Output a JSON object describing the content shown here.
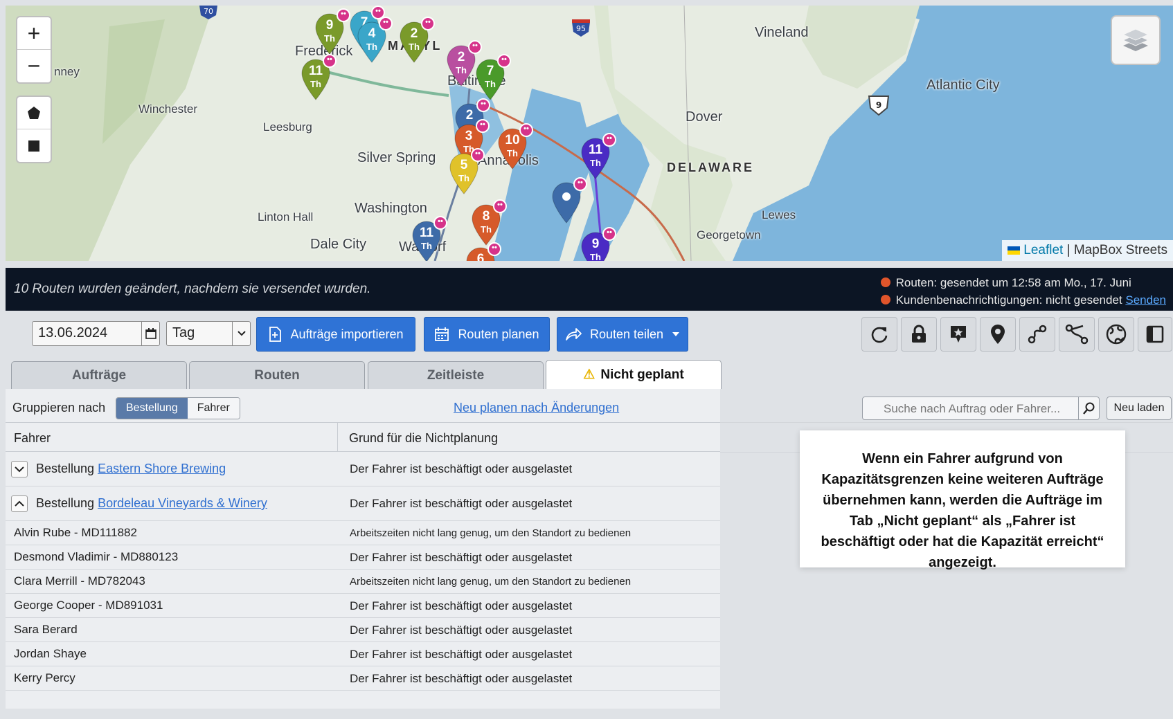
{
  "map": {
    "zoom_in": "+",
    "zoom_out": "−",
    "labels": [
      {
        "text": "Vineland",
        "cls": "big"
      },
      {
        "text": "Frederick",
        "cls": "big"
      },
      {
        "text": "MARYL",
        "cls": "state"
      },
      {
        "text": "Baltimore",
        "cls": "big"
      },
      {
        "text": "Atlantic City",
        "cls": "big"
      },
      {
        "text": "Winchester",
        "cls": "mid"
      },
      {
        "text": "Leesburg",
        "cls": "mid"
      },
      {
        "text": "Dover",
        "cls": "big"
      },
      {
        "text": "Silver Spring",
        "cls": "big"
      },
      {
        "text": "Annapolis",
        "cls": "big"
      },
      {
        "text": "DELAWARE",
        "cls": "state"
      },
      {
        "text": "Washington",
        "cls": "big"
      },
      {
        "text": "Linton Hall",
        "cls": "mid"
      },
      {
        "text": "Lewes",
        "cls": "mid"
      },
      {
        "text": "Dale City",
        "cls": "big"
      },
      {
        "text": "Waldorf",
        "cls": "big"
      },
      {
        "text": "Georgetown",
        "cls": "mid"
      },
      {
        "text": "nney",
        "cls": "mid"
      }
    ],
    "markers": [
      {
        "num": "9",
        "sub": "Th",
        "color": "#7a9a2a",
        "badge": "••"
      },
      {
        "num": "7",
        "sub": "Th",
        "color": "#3aa6c9",
        "badge": "••"
      },
      {
        "num": "4",
        "sub": "Th",
        "color": "#3aa6c9",
        "badge": "••"
      },
      {
        "num": "2",
        "sub": "Th",
        "color": "#7a9a2a",
        "badge": "••"
      },
      {
        "num": "11",
        "sub": "Th",
        "color": "#7a9a2a",
        "badge": "••"
      },
      {
        "num": "2",
        "sub": "Th",
        "color": "#b94fa0",
        "badge": "••"
      },
      {
        "num": "7",
        "sub": "Th",
        "color": "#4a9a2a",
        "badge": "••"
      },
      {
        "num": "2",
        "sub": "",
        "color": "#3d6ba8",
        "badge": "••"
      },
      {
        "num": "3",
        "sub": "Th",
        "color": "#d65a2a",
        "badge": "••"
      },
      {
        "num": "10",
        "sub": "Th",
        "color": "#d65a2a",
        "badge": "••"
      },
      {
        "num": "11",
        "sub": "Th",
        "color": "#4a2bc4",
        "badge": "••"
      },
      {
        "num": "5",
        "sub": "Th",
        "color": "#e0c22a",
        "badge": "••"
      },
      {
        "num": "",
        "sub": "",
        "color": "#3d6ba8",
        "badge": "••"
      },
      {
        "num": "8",
        "sub": "Th",
        "color": "#d65a2a",
        "badge": "••"
      },
      {
        "num": "11",
        "sub": "Th",
        "color": "#3d6ba8",
        "badge": "••"
      },
      {
        "num": "9",
        "sub": "Th",
        "color": "#4a2bc4",
        "badge": "••"
      },
      {
        "num": "6",
        "sub": "",
        "color": "#d65a2a",
        "badge": "••"
      }
    ],
    "shields": [
      "70",
      "95",
      "9"
    ],
    "attribution_leaflet": "Leaflet",
    "attribution_sep": " | ",
    "attribution_tiles": "MapBox Streets"
  },
  "alert": {
    "message": "10 Routen wurden geändert, nachdem sie versendet wurden.",
    "status_routes": "Routen: gesendet um 12:58 am Mo., 17. Juni",
    "status_customers": "Kundenbenachrichtigungen: nicht gesendet",
    "send_link": "Senden",
    "dot_color": "#e0552b"
  },
  "toolbar": {
    "date_value": "13.06.2024",
    "period_value": "Tag",
    "import_label": "Aufträge importieren",
    "plan_label": "Routen planen",
    "share_label": "Routen teilen",
    "accent": "#2f73d6"
  },
  "tabs": [
    {
      "label": "Aufträge"
    },
    {
      "label": "Routen"
    },
    {
      "label": "Zeitleiste"
    },
    {
      "label": "Nicht geplant",
      "icon": "⚠"
    }
  ],
  "group": {
    "label": "Gruppieren nach",
    "option_order": "Bestellung",
    "option_driver": "Fahrer",
    "replan_link": "Neu planen nach Änderungen"
  },
  "search": {
    "placeholder": "Suche nach Auftrag oder Fahrer...",
    "reload_label": "Neu laden"
  },
  "table": {
    "col_driver": "Fahrer",
    "col_reason": "Grund für die Nichtplanung",
    "groups": [
      {
        "prefix": "Bestellung",
        "name": "Eastern Shore Brewing",
        "reason": "Der Fahrer ist beschäftigt oder ausgelastet",
        "toggle": "⌄"
      },
      {
        "prefix": "Bestellung",
        "name": "Bordeleau Vineyards & Winery",
        "reason": "Der Fahrer ist beschäftigt oder ausgelastet",
        "toggle": "⌃"
      }
    ],
    "rows": [
      {
        "name": "Alvin Rube - MD111882",
        "reason": "Arbeitszeiten nicht lang genug, um den Standort zu bedienen",
        "small": true
      },
      {
        "name": "Desmond Vladimir - MD880123",
        "reason": "Der Fahrer ist beschäftigt oder ausgelastet",
        "small": false
      },
      {
        "name": "Clara Merrill - MD782043",
        "reason": "Arbeitszeiten nicht lang genug, um den Standort zu bedienen",
        "small": true
      },
      {
        "name": "George Cooper - MD891031",
        "reason": "Der Fahrer ist beschäftigt oder ausgelastet",
        "small": false
      },
      {
        "name": "Sara Berard",
        "reason": "Der Fahrer ist beschäftigt oder ausgelastet",
        "small": false
      },
      {
        "name": "Jordan Shaye",
        "reason": "Der Fahrer ist beschäftigt oder ausgelastet",
        "small": false
      },
      {
        "name": "Kerry Percy",
        "reason": "Der Fahrer ist beschäftigt oder ausgelastet",
        "small": false
      }
    ]
  },
  "callout": {
    "text": "Wenn ein Fahrer aufgrund von Kapazitätsgrenzen keine weiteren Aufträge übernehmen kann, werden die Aufträge im Tab „Nicht geplant“ als „Fahrer ist beschäftigt oder hat die Kapazität erreicht“ angezeigt."
  }
}
